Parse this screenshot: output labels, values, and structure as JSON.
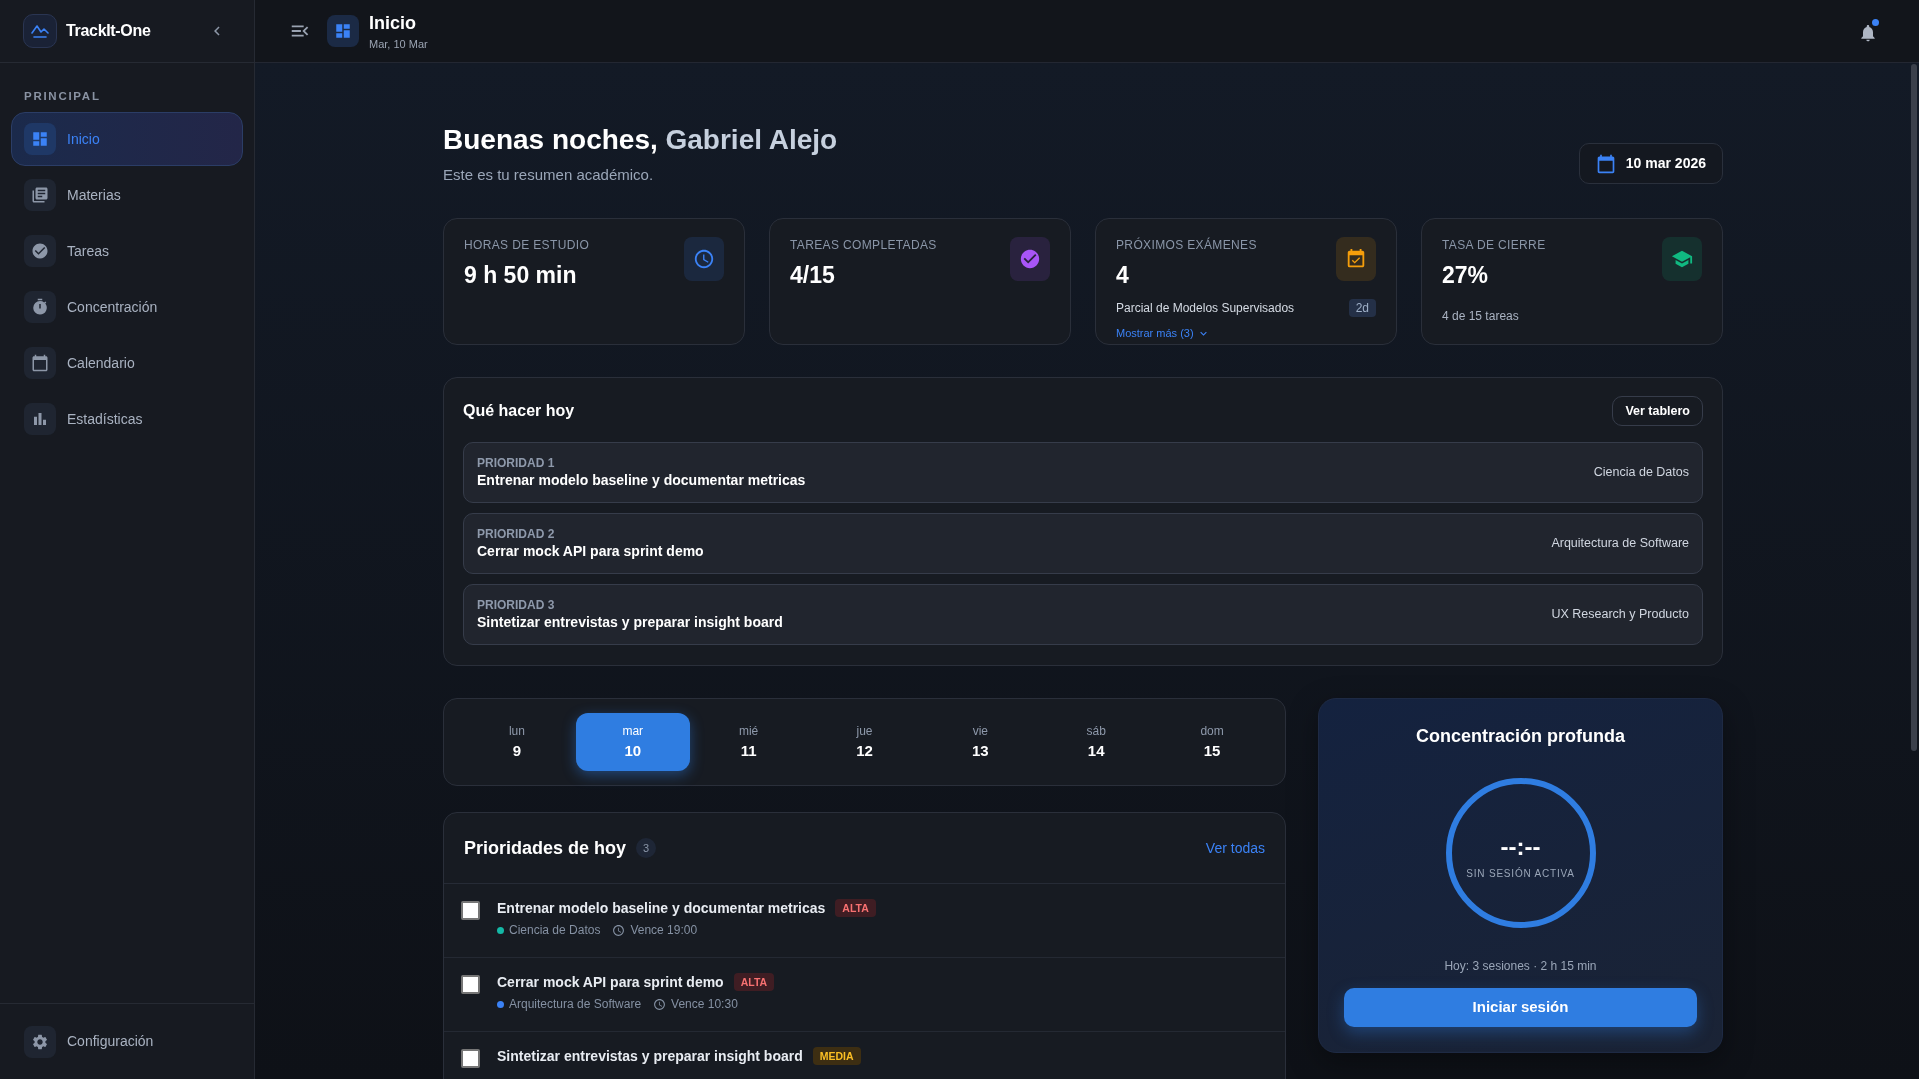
{
  "sidebar": {
    "brand": "TrackIt-One",
    "section": "PRINCIPAL",
    "items": [
      {
        "label": "Inicio",
        "selected": true
      },
      {
        "label": "Materias",
        "selected": false
      },
      {
        "label": "Tareas",
        "selected": false
      },
      {
        "label": "Concentración",
        "selected": false
      },
      {
        "label": "Calendario",
        "selected": false
      },
      {
        "label": "Estadísticas",
        "selected": false
      }
    ],
    "footer_item": {
      "label": "Configuración"
    }
  },
  "topbar": {
    "title": "Inicio",
    "subtitle": "Mar, 10 Mar",
    "notifications": {
      "unread": true
    }
  },
  "greeting": {
    "text": "Buenas noches,",
    "name": "Gabriel Alejo",
    "subtitle": "Este es tu resumen académico.",
    "date": "10 mar 2026"
  },
  "stats": [
    {
      "kind": "time",
      "label": "HORAS DE ESTUDIO",
      "value": "9 h 50 min",
      "color": "#3b82f6"
    },
    {
      "kind": "tasks",
      "label": "TAREAS COMPLETADAS",
      "value": "4/15",
      "color": "#a855f7"
    },
    {
      "kind": "exams",
      "label": "PRÓXIMOS EXÁMENES",
      "value": "4",
      "color": "#f59e0b",
      "detail": "Parcial de Modelos Supervisados",
      "detail_badge": "2d",
      "more_link": "Mostrar más (3)"
    },
    {
      "kind": "rate",
      "label": "TASA DE CIERRE",
      "value": "27%",
      "color": "#10b981",
      "note": "4 de 15 tareas"
    }
  ],
  "today_plan": {
    "title": "Qué hacer hoy",
    "button": "Ver tablero",
    "items": [
      {
        "label": "PRIORIDAD 1",
        "title": "Entrenar modelo baseline y documentar metricas",
        "subject": "Ciencia de Datos"
      },
      {
        "label": "PRIORIDAD 2",
        "title": "Cerrar mock API para sprint demo",
        "subject": "Arquitectura de Software"
      },
      {
        "label": "PRIORIDAD 3",
        "title": "Sintetizar entrevistas y preparar insight board",
        "subject": "UX Research y Producto"
      }
    ]
  },
  "week": [
    {
      "weekday": "lun",
      "day": "9",
      "selected": false
    },
    {
      "weekday": "mar",
      "day": "10",
      "selected": true
    },
    {
      "weekday": "mié",
      "day": "11",
      "selected": false
    },
    {
      "weekday": "jue",
      "day": "12",
      "selected": false
    },
    {
      "weekday": "vie",
      "day": "13",
      "selected": false
    },
    {
      "weekday": "sáb",
      "day": "14",
      "selected": false
    },
    {
      "weekday": "dom",
      "day": "15",
      "selected": false
    }
  ],
  "priorities": {
    "title": "Prioridades de hoy",
    "count": "3",
    "link": "Ver todas",
    "items": [
      {
        "checked": false,
        "title": "Entrenar modelo baseline y documentar metricas",
        "badge": {
          "text": "ALTA",
          "kind": "high"
        },
        "subject": {
          "name": "Ciencia de Datos",
          "color": "#14b8a6"
        },
        "due": "Vence 19:00"
      },
      {
        "checked": false,
        "title": "Cerrar mock API para sprint demo",
        "badge": {
          "text": "ALTA",
          "kind": "high"
        },
        "subject": {
          "name": "Arquitectura de Software",
          "color": "#3b82f6"
        },
        "due": "Vence 10:30"
      },
      {
        "checked": false,
        "title": "Sintetizar entrevistas y preparar insight board",
        "badge": {
          "text": "MEDIA",
          "kind": "medium"
        }
      }
    ]
  },
  "focus": {
    "title": "Concentración profunda",
    "timer": "--:--",
    "status": "SIN SESIÓN ACTIVA",
    "summary": "Hoy: 3 sesiones · 2 h 15 min",
    "button": "Iniciar sesión"
  }
}
